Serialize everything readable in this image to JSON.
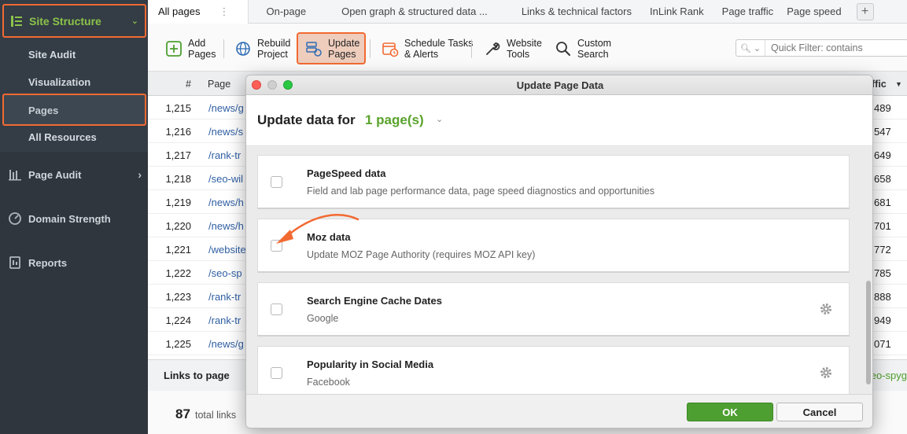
{
  "sidebar": {
    "section_title": "Site Structure",
    "sub_items": [
      "Site Audit",
      "Visualization",
      "Pages",
      "All Resources"
    ],
    "selected": "Pages",
    "main_items": [
      {
        "label": "Page Audit",
        "icon": "page-audit-icon"
      },
      {
        "label": "Domain Strength",
        "icon": "domain-strength-icon"
      },
      {
        "label": "Reports",
        "icon": "reports-icon"
      }
    ]
  },
  "tabs": {
    "items": [
      "All pages",
      "On-page",
      "Open graph & structured data ...",
      "Links & technical factors",
      "InLink Rank",
      "Page traffic",
      "Page speed"
    ],
    "add_label": "+"
  },
  "toolbar": {
    "add": [
      "Add",
      "Pages"
    ],
    "rebuild": [
      "Rebuild",
      "Project"
    ],
    "update": [
      "Update",
      "Pages"
    ],
    "schedule": [
      "Schedule Tasks",
      "& Alerts"
    ],
    "tools": [
      "Website",
      "Tools"
    ],
    "custom": [
      "Custom",
      "Search"
    ],
    "filter_placeholder": "Quick Filter: contains"
  },
  "table": {
    "headers": {
      "num": "#",
      "page": "Page",
      "traffic": "ffic"
    },
    "rows": [
      {
        "num": "1,215",
        "page": "/news/g",
        "traffic": "489"
      },
      {
        "num": "1,216",
        "page": "/news/s",
        "traffic": "547"
      },
      {
        "num": "1,217",
        "page": "/rank-tr",
        "traffic": "649"
      },
      {
        "num": "1,218",
        "page": "/seo-wil",
        "traffic": "658"
      },
      {
        "num": "1,219",
        "page": "/news/h",
        "traffic": "681"
      },
      {
        "num": "1,220",
        "page": "/news/h",
        "traffic": "701"
      },
      {
        "num": "1,221",
        "page": "/website",
        "traffic": "772"
      },
      {
        "num": "1,222",
        "page": "/seo-sp",
        "traffic": "785"
      },
      {
        "num": "1,223",
        "page": "/rank-tr",
        "traffic": "888"
      },
      {
        "num": "1,224",
        "page": "/rank-tr",
        "traffic": "949"
      },
      {
        "num": "1,225",
        "page": "/news/g",
        "traffic": "071"
      }
    ]
  },
  "links": {
    "title": "Links to page",
    "green_text": "eo-spyg",
    "total_num": "87",
    "total_label": "total links"
  },
  "modal": {
    "window_title": "Update Page Data",
    "heading": "Update data for",
    "count": "1 page(s)",
    "options": [
      {
        "title": "PageSpeed data",
        "desc": "Field and lab page performance data, page speed diagnostics and opportunities",
        "gear": false
      },
      {
        "title": "Moz data",
        "desc": "Update MOZ Page Authority (requires MOZ API key)",
        "gear": false
      },
      {
        "title": "Search Engine Cache Dates",
        "desc": "Google",
        "gear": true
      },
      {
        "title": "Popularity in Social Media",
        "desc": "Facebook",
        "gear": true
      }
    ],
    "ok_label": "OK",
    "cancel_label": "Cancel"
  },
  "colors": {
    "accent_green": "#5aa22c",
    "highlight_orange": "#f26a32",
    "sidebar": "#343c45"
  }
}
